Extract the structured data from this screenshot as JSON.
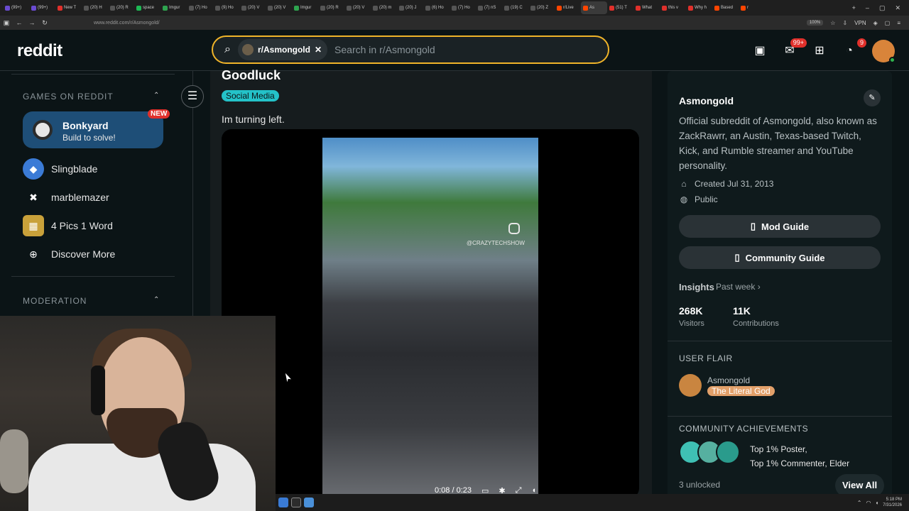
{
  "browser": {
    "tabs": [
      "(99+)",
      "(99+)",
      "New T",
      "(20) H",
      "(20) R",
      "space",
      "Imgur",
      "(7) Ho",
      "(9) Ho",
      "(20) V",
      "(20) V",
      "Imgur",
      "(20) R",
      "(20) V",
      "(20) m",
      "(20) J",
      "(6) Ho",
      "(7) Ho",
      "(7) nS",
      "(19) C",
      "(20) Z",
      "r/Live",
      "As",
      "(51) T",
      "What",
      "this v",
      "Why h",
      "Based",
      "r"
    ],
    "active_tab_index": 22,
    "url": "www.reddit.com/r/Asmongold/",
    "zoom": "100%",
    "vpn_label": "VPN"
  },
  "header": {
    "logo": "reddit",
    "search_chip": "r/Asmongold",
    "search_placeholder": "Search in r/Asmongold",
    "chat_badge": "99+",
    "notif_badge": "9"
  },
  "sidebar": {
    "games_title": "GAMES ON REDDIT",
    "featured": {
      "title": "Bonkyard",
      "subtitle": "Build to solve!",
      "badge": "NEW"
    },
    "games": [
      {
        "label": "Slingblade"
      },
      {
        "label": "marblemazer"
      },
      {
        "label": "4 Pics 1 Word"
      },
      {
        "label": "Discover More"
      }
    ],
    "moderation_title": "MODERATION"
  },
  "post": {
    "title": "Goodluck",
    "flair": "Social Media",
    "body": "Im turning left.",
    "video_watermark": "@CRAZYTECHSHOW",
    "video_time": "0:08 / 0:23"
  },
  "community": {
    "name": "Asmongold",
    "description": "Official subreddit of Asmongold, also known as ZackRawrr, an Austin, Texas-based Twitch, Kick, and Rumble streamer and YouTube personality.",
    "created": "Created Jul 31, 2013",
    "visibility": "Public",
    "mod_guide": "Mod Guide",
    "community_guide": "Community Guide",
    "insights_label": "Insights",
    "insights_period": "Past week",
    "visitors_value": "268K",
    "visitors_label": "Visitors",
    "contributions_value": "11K",
    "contributions_label": "Contributions",
    "user_flair_title": "USER FLAIR",
    "user_name": "Asmongold",
    "user_flair": "The Literal God",
    "achievements_title": "COMMUNITY ACHIEVEMENTS",
    "achievements_line1": "Top 1% Poster,",
    "achievements_line2": "Top 1% Commenter, Elder",
    "unlocked": "3 unlocked",
    "view_all": "View All"
  },
  "taskbar": {
    "time": "5:18 PM",
    "date": "7/31/2026"
  },
  "colors": {
    "accent_search": "#f0b429",
    "flair": "#24c2c8",
    "badge": "#e0302b",
    "featured_bg": "#1e4e77"
  }
}
